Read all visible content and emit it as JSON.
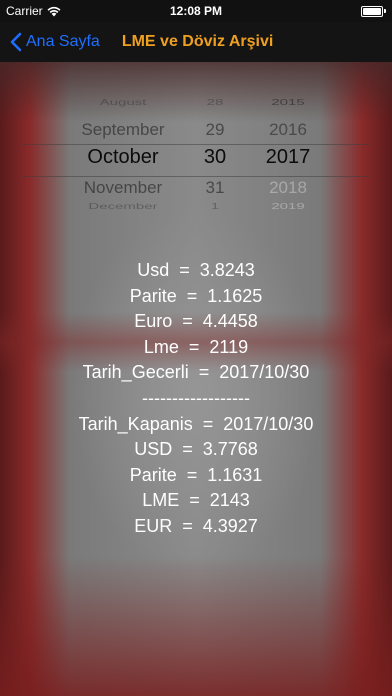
{
  "status": {
    "carrier": "Carrier",
    "time": "12:08 PM"
  },
  "nav": {
    "back_label": "Ana Sayfa",
    "title": "LME ve Döviz Arşivi"
  },
  "picker": {
    "rows": [
      {
        "month": "August",
        "day": "28",
        "year": "2015"
      },
      {
        "month": "September",
        "day": "29",
        "year": "2016"
      },
      {
        "month": "October",
        "day": "30",
        "year": "2017"
      },
      {
        "month": "November",
        "day": "31",
        "year": "2018"
      },
      {
        "month": "December",
        "day": "1",
        "year": "2019"
      }
    ]
  },
  "results": {
    "lines": [
      "Usd  =  3.8243",
      "Parite  =  1.1625",
      "Euro  =  4.4458",
      "Lme  =  2119",
      "Tarih_Gecerli  =  2017/10/30",
      "------------------",
      "Tarih_Kapanis  =  2017/10/30",
      "USD  =  3.7768",
      "Parite  =  1.1631",
      "LME  =  2143",
      "EUR  =  4.3927"
    ]
  },
  "colors": {
    "nav_background": "#141414",
    "back_link": "#1e6fff",
    "title": "#f0a020"
  }
}
